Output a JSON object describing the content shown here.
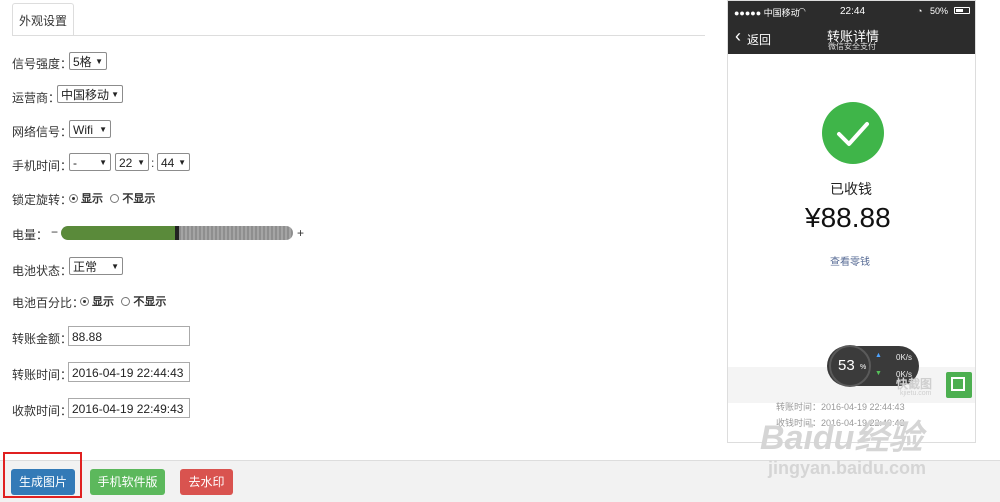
{
  "tab": {
    "label": "外观设置"
  },
  "form": {
    "signal": {
      "label": "信号强度：",
      "value": "5格"
    },
    "carrier": {
      "label": "运营商：",
      "value": "中国移动"
    },
    "network": {
      "label": "网络信号：",
      "value": "Wifi"
    },
    "phone_time": {
      "label": "手机时间：",
      "ampm": "-",
      "hour": "22",
      "sep": ":",
      "minute": "44"
    },
    "rotation_lock": {
      "label": "锁定旋转：",
      "opt_show": "显示",
      "opt_hide": "不显示",
      "selected": "显示"
    },
    "battery": {
      "label": "电量：",
      "minus": "−",
      "plus": "+",
      "level_percent": 50
    },
    "battery_state": {
      "label": "电池状态：",
      "value": "正常"
    },
    "battery_percent": {
      "label": "电池百分比：",
      "opt_show": "显示",
      "opt_hide": "不显示",
      "selected": "显示"
    },
    "amount": {
      "label": "转账金额：",
      "value": "88.88"
    },
    "transfer_time": {
      "label": "转账时间：",
      "value": "2016-04-19 22:44:43"
    },
    "receive_time": {
      "label": "收款时间：",
      "value": "2016-04-19 22:49:43"
    }
  },
  "buttons": {
    "generate": "生成图片",
    "mobile": "手机软件版",
    "watermark": "去水印",
    "colors": {
      "generate": "#337ab7",
      "mobile": "#5cb85c",
      "watermark": "#d9534f"
    }
  },
  "phone": {
    "carrier": "●●●●● 中国移动",
    "time": "22:44",
    "battery": "50%",
    "back": "返回",
    "title": "转账详情",
    "subtitle": "微信安全支付",
    "status": "已收钱",
    "amount": "¥88.88",
    "link": "查看零钱",
    "row1": "转账时间：2016-04-19 22:44:43",
    "row2": "收钱时间：2016-04-19 22:49:43",
    "check_color": "#3fb549"
  },
  "overlay": {
    "percent": "53",
    "percent_unit": "%",
    "up": "0K/s",
    "down": "0K/s",
    "brand": "快截图",
    "brand_sub": "kjietu.com"
  },
  "watermark": {
    "text": "Baidu经验",
    "url": "jingyan.baidu.com"
  }
}
